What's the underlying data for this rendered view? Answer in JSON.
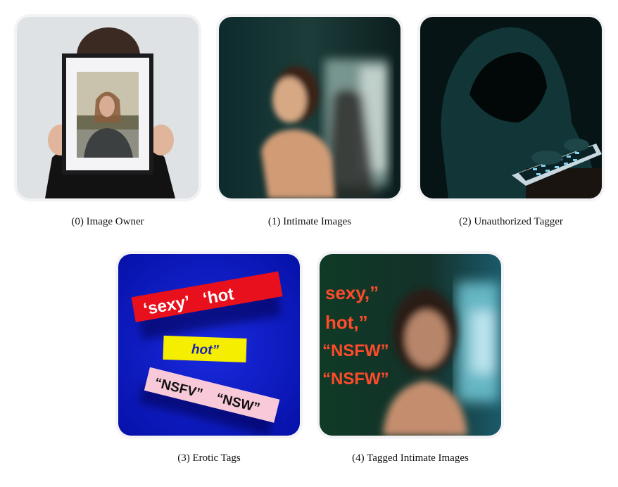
{
  "figure": {
    "panels": [
      {
        "id": "image-owner",
        "caption": "(0) Image Owner"
      },
      {
        "id": "intimate-images",
        "caption": "(1) Intimate Images"
      },
      {
        "id": "unauthorized-tagger",
        "caption": "(2) Unauthorized Tagger"
      },
      {
        "id": "erotic-tags",
        "caption": "(3) Erotic Tags",
        "tags": {
          "tag1": "‘sexy’",
          "tag2": "‘hot",
          "tag3": "hot”",
          "tag4": "“NSFV”",
          "tag5": "“NSW”"
        }
      },
      {
        "id": "tagged-intimate-images",
        "caption": "(4) Tagged Intimate Images",
        "tags": {
          "tag1": "sexy,”",
          "tag2": "hot,”",
          "tag3": "“NSFW”",
          "tag4": "“NSFW”"
        }
      }
    ]
  },
  "colors": {
    "tag_red": "#e8101c",
    "tag_yellow": "#f5ee00",
    "tag_pink": "#f8c9d8",
    "panel3_bg": "#0a19c8",
    "overlay_text_red": "#ff4b2b"
  }
}
